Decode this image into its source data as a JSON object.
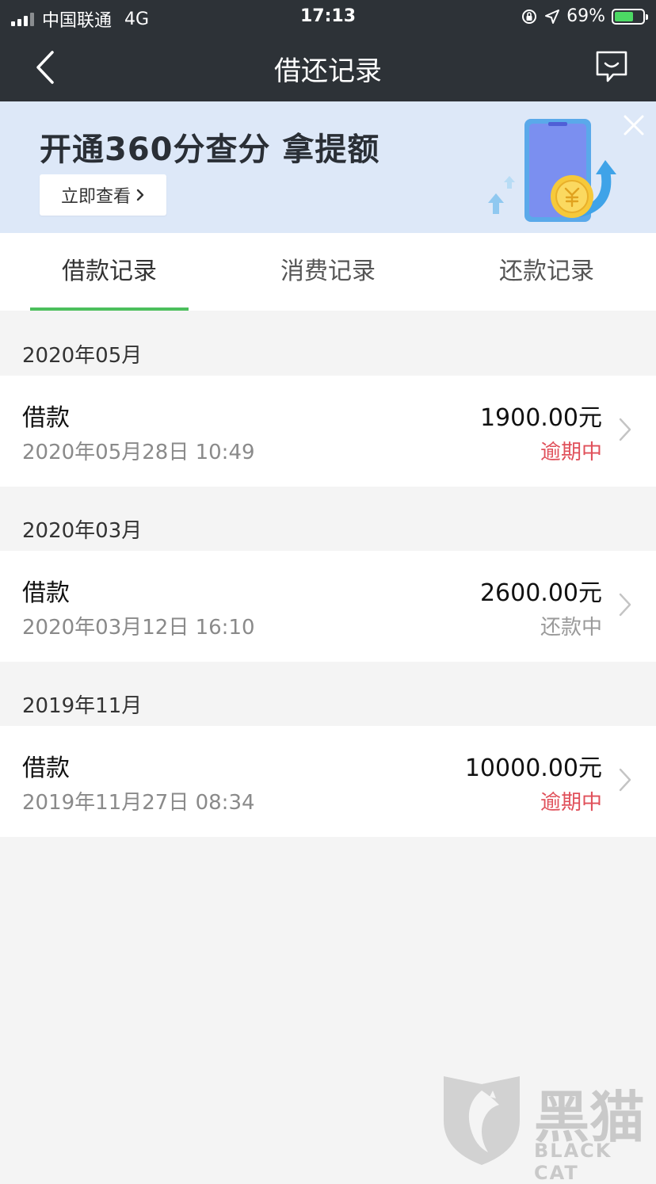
{
  "status_bar": {
    "carrier": "中国联通",
    "network": "4G",
    "time": "17:13",
    "battery": "69%",
    "battery_level": 0.69,
    "icons": [
      "orientation-lock-icon",
      "location-icon",
      "battery-charging-icon"
    ]
  },
  "nav": {
    "title": "借还记录",
    "back_icon": "chevron-left-icon",
    "feedback_icon": "chat-bubble-icon"
  },
  "banner": {
    "title": "开通360分查分 拿提额",
    "button_label": "立即查看",
    "button_icon": "chevron-right-icon",
    "close_icon": "close-icon"
  },
  "tabs": [
    {
      "label": "借款记录",
      "active": true
    },
    {
      "label": "消费记录",
      "active": false
    },
    {
      "label": "还款记录",
      "active": false
    }
  ],
  "colors": {
    "accent_green": "#4bbf5c",
    "overdue_red": "#e0505a",
    "header_dark": "#2d3237",
    "banner_bg": "#dde8f8"
  },
  "records": [
    {
      "month": "2020年05月",
      "type": "借款",
      "datetime": "2020年05月28日 10:49",
      "amount": "1900.00元",
      "status": "逾期中",
      "status_color": "#e0505a"
    },
    {
      "month": "2020年03月",
      "type": "借款",
      "datetime": "2020年03月12日 16:10",
      "amount": "2600.00元",
      "status": "还款中",
      "status_color": "#9a9a9a"
    },
    {
      "month": "2019年11月",
      "type": "借款",
      "datetime": "2019年11月27日 08:34",
      "amount": "10000.00元",
      "status": "逾期中",
      "status_color": "#e0505a"
    }
  ],
  "watermark": {
    "text_cn": "黑猫",
    "text_en": "BLACK CAT"
  }
}
